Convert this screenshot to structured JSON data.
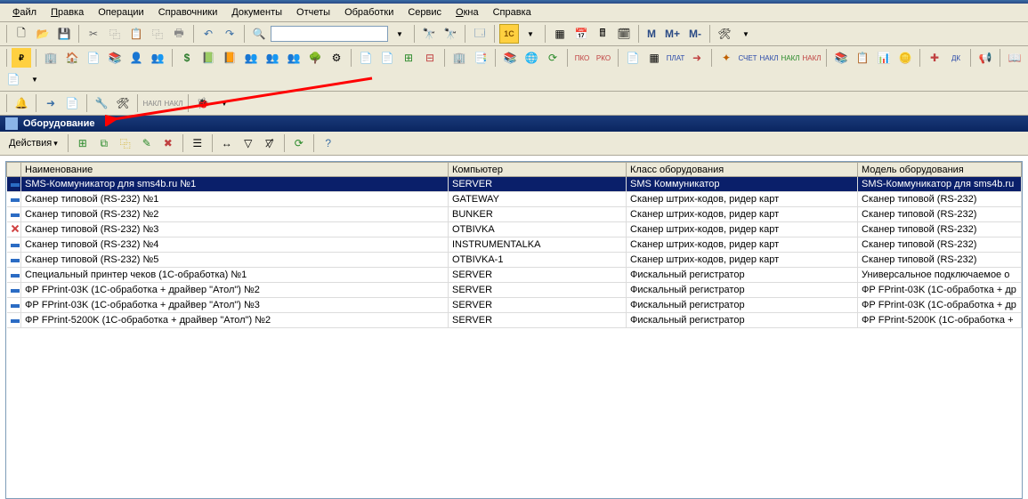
{
  "menu": [
    "Файл",
    "Правка",
    "Операции",
    "Справочники",
    "Документы",
    "Отчеты",
    "Обработки",
    "Сервис",
    "Окна",
    "Справка"
  ],
  "menu_underline": [
    "Ф",
    "П",
    "",
    "",
    "",
    "",
    "",
    "",
    "О",
    ""
  ],
  "toolbar1": {
    "search_placeholder": "",
    "mem_labels": [
      "M",
      "M+",
      "M-"
    ]
  },
  "window_title": "Оборудование",
  "actions_label": "Действия",
  "columns": [
    "",
    "Наименование",
    "Компьютер",
    "Класс оборудования",
    "Модель оборудования"
  ],
  "rows": [
    {
      "icon": "blue",
      "name": "SMS-Коммуникатор для sms4b.ru №1",
      "computer": "SERVER",
      "class": "SMS Коммуникатор",
      "model": "SMS-Коммуникатор для sms4b.ru",
      "selected": true
    },
    {
      "icon": "blue",
      "name": "Сканер типовой (RS-232) №1",
      "computer": "GATEWAY",
      "class": "Сканер штрих-кодов, ридер карт",
      "model": "Сканер типовой (RS-232)"
    },
    {
      "icon": "blue",
      "name": "Сканер типовой (RS-232) №2",
      "computer": "BUNKER",
      "class": "Сканер штрих-кодов, ридер карт",
      "model": "Сканер типовой (RS-232)"
    },
    {
      "icon": "red",
      "name": "Сканер типовой (RS-232) №3",
      "computer": "OTBIVKA",
      "class": "Сканер штрих-кодов, ридер карт",
      "model": "Сканер типовой (RS-232)"
    },
    {
      "icon": "blue",
      "name": "Сканер типовой (RS-232) №4",
      "computer": "INSTRUMENTALKA",
      "class": "Сканер штрих-кодов, ридер карт",
      "model": "Сканер типовой (RS-232)"
    },
    {
      "icon": "blue",
      "name": "Сканер типовой (RS-232) №5",
      "computer": "OTBIVKA-1",
      "class": "Сканер штрих-кодов, ридер карт",
      "model": "Сканер типовой (RS-232)"
    },
    {
      "icon": "blue",
      "name": "Специальный принтер чеков (1С-обработка) №1",
      "computer": "SERVER",
      "class": "Фискальный регистратор",
      "model": "Универсальное подключаемое о"
    },
    {
      "icon": "blue",
      "name": "ФР FPrint-03K (1С-обработка + драйвер \"Атол\") №2",
      "computer": "SERVER",
      "class": "Фискальный регистратор",
      "model": "ФР FPrint-03K (1С-обработка + др"
    },
    {
      "icon": "blue",
      "name": "ФР FPrint-03K (1С-обработка + драйвер \"Атол\") №3",
      "computer": "SERVER",
      "class": "Фискальный регистратор",
      "model": "ФР FPrint-03K (1С-обработка + др"
    },
    {
      "icon": "blue",
      "name": "ФР FPrint-5200K (1С-обработка + драйвер \"Атол\") №2",
      "computer": "SERVER",
      "class": "Фискальный регистратор",
      "model": "ФР FPrint-5200K (1С-обработка + "
    }
  ],
  "icons": {
    "new": "📄",
    "open": "📂",
    "save": "💾",
    "cut": "✂",
    "copy": "⿻",
    "paste": "📋",
    "print": "🖶",
    "undo": "↶",
    "redo": "↷",
    "find": "🔍",
    "calc": "🖩",
    "cal": "📅",
    "help": "?",
    "refresh": "⟳",
    "add": "➕",
    "edit": "✎",
    "delete": "✖",
    "filter": "▽",
    "home": "🏠",
    "org": "🏢",
    "users": "👥",
    "money": "💲",
    "doc": "📑",
    "report": "📊",
    "gear": "⚙",
    "book": "📚",
    "arrow": "➜",
    "wrench": "🔧"
  }
}
